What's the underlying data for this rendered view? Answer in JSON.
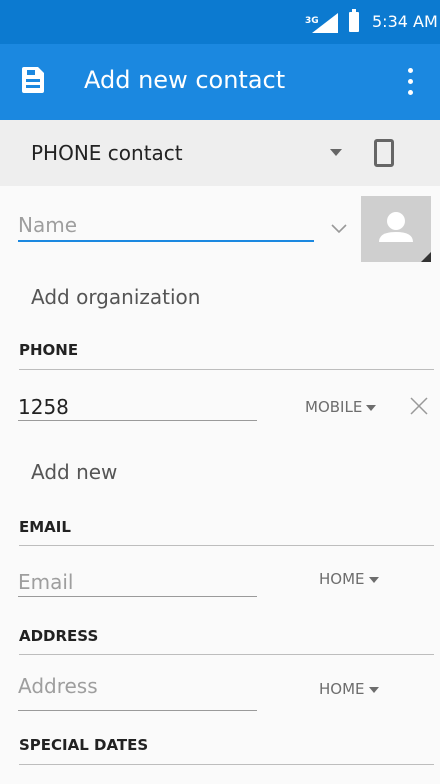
{
  "status_bar": {
    "network": "3G",
    "time": "5:34 AM"
  },
  "toolbar": {
    "title": "Add new contact"
  },
  "account": {
    "label": "PHONE contact"
  },
  "name_field": {
    "placeholder": "Name"
  },
  "organization": {
    "label": "Add organization"
  },
  "phone_section": {
    "title": "PHONE",
    "value": "1258",
    "type": "MOBILE",
    "add_new": "Add new"
  },
  "email_section": {
    "title": "EMAIL",
    "placeholder": "Email",
    "type": "HOME"
  },
  "address_section": {
    "title": "ADDRESS",
    "placeholder": "Address",
    "type": "HOME"
  },
  "special_dates_section": {
    "title": "SPECIAL DATES"
  },
  "colors": {
    "status_bar": "#0c7ad0",
    "toolbar": "#1b88e0",
    "accent_underline": "#1b88e0"
  }
}
